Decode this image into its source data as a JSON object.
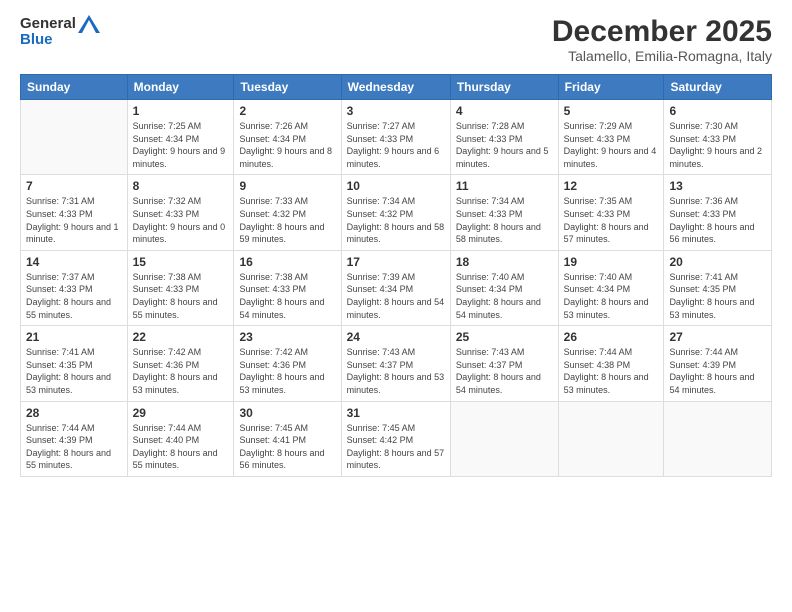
{
  "logo": {
    "general": "General",
    "blue": "Blue"
  },
  "header": {
    "month": "December 2025",
    "location": "Talamello, Emilia-Romagna, Italy"
  },
  "weekdays": [
    "Sunday",
    "Monday",
    "Tuesday",
    "Wednesday",
    "Thursday",
    "Friday",
    "Saturday"
  ],
  "weeks": [
    [
      {
        "day": "",
        "sunrise": "",
        "sunset": "",
        "daylight": ""
      },
      {
        "day": "1",
        "sunrise": "Sunrise: 7:25 AM",
        "sunset": "Sunset: 4:34 PM",
        "daylight": "Daylight: 9 hours and 9 minutes."
      },
      {
        "day": "2",
        "sunrise": "Sunrise: 7:26 AM",
        "sunset": "Sunset: 4:34 PM",
        "daylight": "Daylight: 9 hours and 8 minutes."
      },
      {
        "day": "3",
        "sunrise": "Sunrise: 7:27 AM",
        "sunset": "Sunset: 4:33 PM",
        "daylight": "Daylight: 9 hours and 6 minutes."
      },
      {
        "day": "4",
        "sunrise": "Sunrise: 7:28 AM",
        "sunset": "Sunset: 4:33 PM",
        "daylight": "Daylight: 9 hours and 5 minutes."
      },
      {
        "day": "5",
        "sunrise": "Sunrise: 7:29 AM",
        "sunset": "Sunset: 4:33 PM",
        "daylight": "Daylight: 9 hours and 4 minutes."
      },
      {
        "day": "6",
        "sunrise": "Sunrise: 7:30 AM",
        "sunset": "Sunset: 4:33 PM",
        "daylight": "Daylight: 9 hours and 2 minutes."
      }
    ],
    [
      {
        "day": "7",
        "sunrise": "Sunrise: 7:31 AM",
        "sunset": "Sunset: 4:33 PM",
        "daylight": "Daylight: 9 hours and 1 minute."
      },
      {
        "day": "8",
        "sunrise": "Sunrise: 7:32 AM",
        "sunset": "Sunset: 4:33 PM",
        "daylight": "Daylight: 9 hours and 0 minutes."
      },
      {
        "day": "9",
        "sunrise": "Sunrise: 7:33 AM",
        "sunset": "Sunset: 4:32 PM",
        "daylight": "Daylight: 8 hours and 59 minutes."
      },
      {
        "day": "10",
        "sunrise": "Sunrise: 7:34 AM",
        "sunset": "Sunset: 4:32 PM",
        "daylight": "Daylight: 8 hours and 58 minutes."
      },
      {
        "day": "11",
        "sunrise": "Sunrise: 7:34 AM",
        "sunset": "Sunset: 4:33 PM",
        "daylight": "Daylight: 8 hours and 58 minutes."
      },
      {
        "day": "12",
        "sunrise": "Sunrise: 7:35 AM",
        "sunset": "Sunset: 4:33 PM",
        "daylight": "Daylight: 8 hours and 57 minutes."
      },
      {
        "day": "13",
        "sunrise": "Sunrise: 7:36 AM",
        "sunset": "Sunset: 4:33 PM",
        "daylight": "Daylight: 8 hours and 56 minutes."
      }
    ],
    [
      {
        "day": "14",
        "sunrise": "Sunrise: 7:37 AM",
        "sunset": "Sunset: 4:33 PM",
        "daylight": "Daylight: 8 hours and 55 minutes."
      },
      {
        "day": "15",
        "sunrise": "Sunrise: 7:38 AM",
        "sunset": "Sunset: 4:33 PM",
        "daylight": "Daylight: 8 hours and 55 minutes."
      },
      {
        "day": "16",
        "sunrise": "Sunrise: 7:38 AM",
        "sunset": "Sunset: 4:33 PM",
        "daylight": "Daylight: 8 hours and 54 minutes."
      },
      {
        "day": "17",
        "sunrise": "Sunrise: 7:39 AM",
        "sunset": "Sunset: 4:34 PM",
        "daylight": "Daylight: 8 hours and 54 minutes."
      },
      {
        "day": "18",
        "sunrise": "Sunrise: 7:40 AM",
        "sunset": "Sunset: 4:34 PM",
        "daylight": "Daylight: 8 hours and 54 minutes."
      },
      {
        "day": "19",
        "sunrise": "Sunrise: 7:40 AM",
        "sunset": "Sunset: 4:34 PM",
        "daylight": "Daylight: 8 hours and 53 minutes."
      },
      {
        "day": "20",
        "sunrise": "Sunrise: 7:41 AM",
        "sunset": "Sunset: 4:35 PM",
        "daylight": "Daylight: 8 hours and 53 minutes."
      }
    ],
    [
      {
        "day": "21",
        "sunrise": "Sunrise: 7:41 AM",
        "sunset": "Sunset: 4:35 PM",
        "daylight": "Daylight: 8 hours and 53 minutes."
      },
      {
        "day": "22",
        "sunrise": "Sunrise: 7:42 AM",
        "sunset": "Sunset: 4:36 PM",
        "daylight": "Daylight: 8 hours and 53 minutes."
      },
      {
        "day": "23",
        "sunrise": "Sunrise: 7:42 AM",
        "sunset": "Sunset: 4:36 PM",
        "daylight": "Daylight: 8 hours and 53 minutes."
      },
      {
        "day": "24",
        "sunrise": "Sunrise: 7:43 AM",
        "sunset": "Sunset: 4:37 PM",
        "daylight": "Daylight: 8 hours and 53 minutes."
      },
      {
        "day": "25",
        "sunrise": "Sunrise: 7:43 AM",
        "sunset": "Sunset: 4:37 PM",
        "daylight": "Daylight: 8 hours and 54 minutes."
      },
      {
        "day": "26",
        "sunrise": "Sunrise: 7:44 AM",
        "sunset": "Sunset: 4:38 PM",
        "daylight": "Daylight: 8 hours and 53 minutes."
      },
      {
        "day": "27",
        "sunrise": "Sunrise: 7:44 AM",
        "sunset": "Sunset: 4:39 PM",
        "daylight": "Daylight: 8 hours and 54 minutes."
      }
    ],
    [
      {
        "day": "28",
        "sunrise": "Sunrise: 7:44 AM",
        "sunset": "Sunset: 4:39 PM",
        "daylight": "Daylight: 8 hours and 55 minutes."
      },
      {
        "day": "29",
        "sunrise": "Sunrise: 7:44 AM",
        "sunset": "Sunset: 4:40 PM",
        "daylight": "Daylight: 8 hours and 55 minutes."
      },
      {
        "day": "30",
        "sunrise": "Sunrise: 7:45 AM",
        "sunset": "Sunset: 4:41 PM",
        "daylight": "Daylight: 8 hours and 56 minutes."
      },
      {
        "day": "31",
        "sunrise": "Sunrise: 7:45 AM",
        "sunset": "Sunset: 4:42 PM",
        "daylight": "Daylight: 8 hours and 57 minutes."
      },
      {
        "day": "",
        "sunrise": "",
        "sunset": "",
        "daylight": ""
      },
      {
        "day": "",
        "sunrise": "",
        "sunset": "",
        "daylight": ""
      },
      {
        "day": "",
        "sunrise": "",
        "sunset": "",
        "daylight": ""
      }
    ]
  ]
}
